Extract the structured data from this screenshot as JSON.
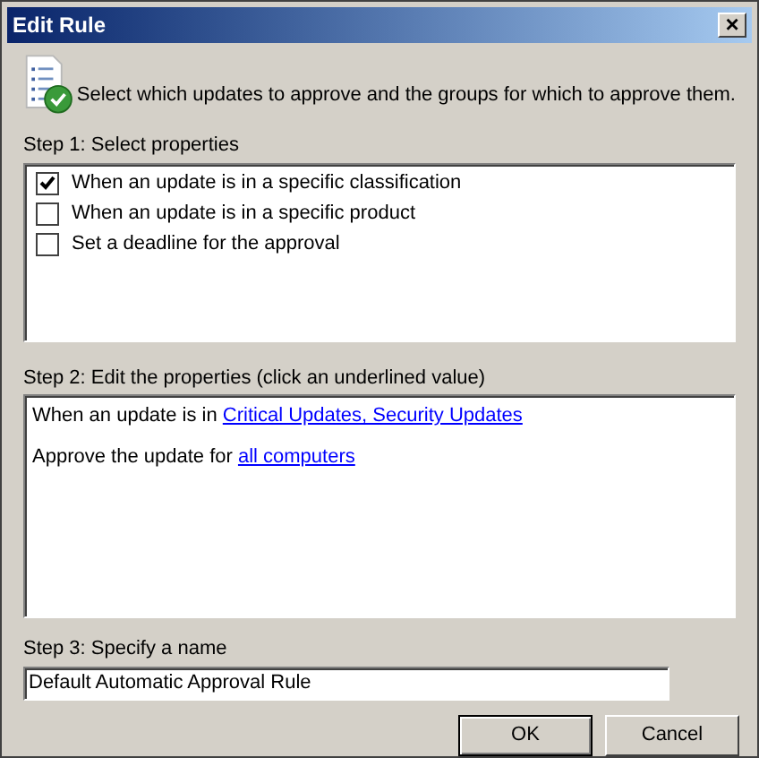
{
  "window": {
    "title": "Edit Rule",
    "close": "×"
  },
  "instruction": "Select which updates to approve and the groups for which to approve them.",
  "step1": {
    "label": "Step 1: Select properties",
    "items": [
      {
        "label": "When an update is in a specific classification",
        "checked": true
      },
      {
        "label": "When an update is in a specific product",
        "checked": false
      },
      {
        "label": "Set a deadline for the approval",
        "checked": false
      }
    ]
  },
  "step2": {
    "label": "Step 2: Edit the properties (click an underlined value)",
    "lines": [
      {
        "text": "When an update is in ",
        "link": "Critical Updates, Security Updates"
      },
      {
        "text": "Approve the update for ",
        "link": "all computers"
      }
    ]
  },
  "step3": {
    "label": "Step 3: Specify a name",
    "value": "Default Automatic Approval Rule"
  },
  "buttons": [
    "OK",
    "Cancel"
  ]
}
